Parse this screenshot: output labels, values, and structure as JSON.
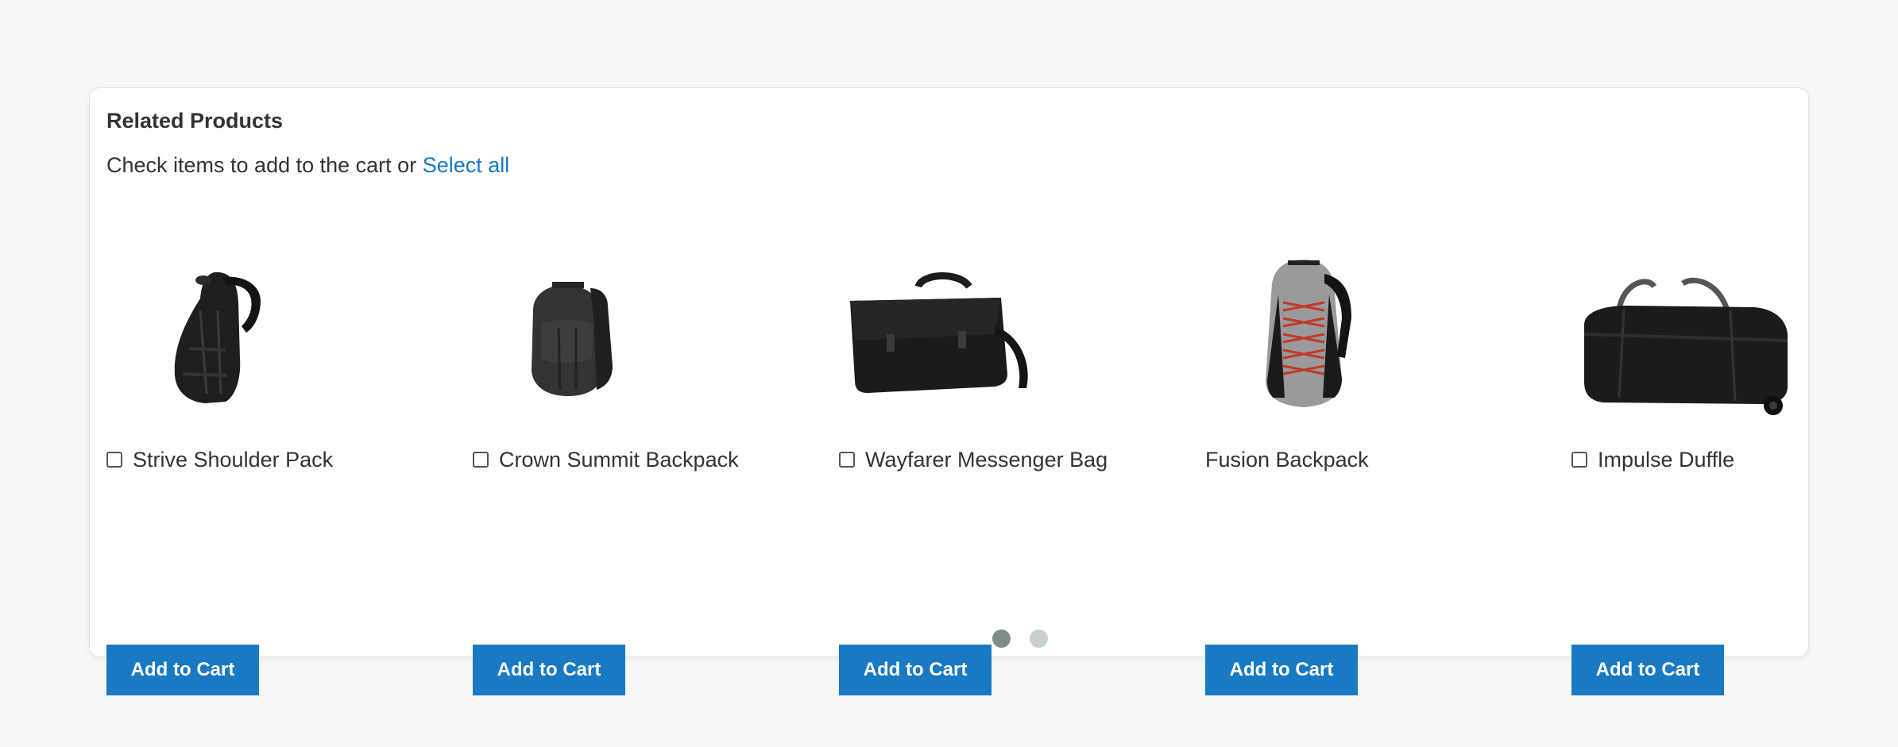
{
  "section": {
    "title": "Related Products",
    "intro_text": "Check items to add to the cart or ",
    "select_all_label": "Select all"
  },
  "products": [
    {
      "name": "Strive Shoulder Pack",
      "has_checkbox": true,
      "add_label": "Add to Cart"
    },
    {
      "name": "Crown Summit Backpack",
      "has_checkbox": true,
      "add_label": "Add to Cart"
    },
    {
      "name": "Wayfarer Messenger Bag",
      "has_checkbox": true,
      "add_label": "Add to Cart"
    },
    {
      "name": "Fusion Backpack",
      "has_checkbox": false,
      "add_label": "Add to Cart"
    },
    {
      "name": "Impulse Duffle",
      "has_checkbox": true,
      "add_label": "Add to Cart"
    }
  ],
  "pagination": {
    "pages": 2,
    "active_page": 1,
    "active_color": "#7f8c8d",
    "inactive_color": "#c5d0cf"
  },
  "colors": {
    "accent": "#1979c3",
    "background": "#f7f7f7",
    "panel": "#ffffff",
    "text": "#333333"
  }
}
